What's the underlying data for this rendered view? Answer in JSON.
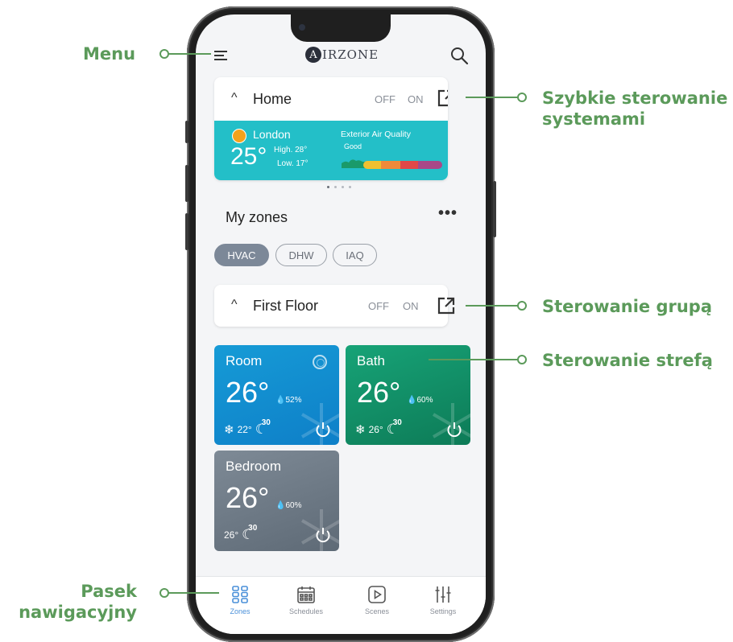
{
  "callouts": {
    "menu": "Menu",
    "quick_control_1": "Szybkie sterowanie",
    "quick_control_2": "systemami",
    "group_control": "Sterowanie grupą",
    "zone_control": "Sterowanie strefą",
    "nav_bar_1": "Pasek",
    "nav_bar_2": "nawigacyjny"
  },
  "app": {
    "logo_letter": "A",
    "logo_text": "IRZONE"
  },
  "home_card": {
    "title": "Home",
    "off_label": "OFF",
    "on_label": "ON",
    "weather": {
      "city": "London",
      "temperature": "25°",
      "high": "High. 28°",
      "low": "Low. 17°",
      "air_quality_label": "Exterior Air Quality",
      "air_quality_value": "Good"
    }
  },
  "my_zones": {
    "title": "My zones",
    "more": "•••",
    "filters": [
      "HVAC",
      "DHW",
      "IAQ"
    ],
    "active_filter": "HVAC"
  },
  "group_card": {
    "title": "First Floor",
    "off_label": "OFF",
    "on_label": "ON"
  },
  "zones": [
    {
      "name": "Room",
      "temperature": "26°",
      "humidity": "52%",
      "setpoint": "22°",
      "sleep": "30",
      "color": "#169bd6"
    },
    {
      "name": "Bath",
      "temperature": "26°",
      "humidity": "60%",
      "setpoint": "26°",
      "sleep": "30",
      "color": "#17a377"
    },
    {
      "name": "Bedroom",
      "temperature": "26°",
      "humidity": "60%",
      "setpoint": "26°",
      "sleep": "30",
      "color": "#7e8a96"
    }
  ],
  "nav": [
    {
      "label": "Zones",
      "icon": "zones-grid-icon",
      "active": true
    },
    {
      "label": "Schedules",
      "icon": "calendar-icon",
      "active": false
    },
    {
      "label": "Scenes",
      "icon": "play-icon",
      "active": false
    },
    {
      "label": "Settings",
      "icon": "sliders-icon",
      "active": false
    }
  ],
  "colors": {
    "callout": "#5b9a5a",
    "weather_bg": "#23bfc8",
    "nav_active": "#4a90d9"
  }
}
